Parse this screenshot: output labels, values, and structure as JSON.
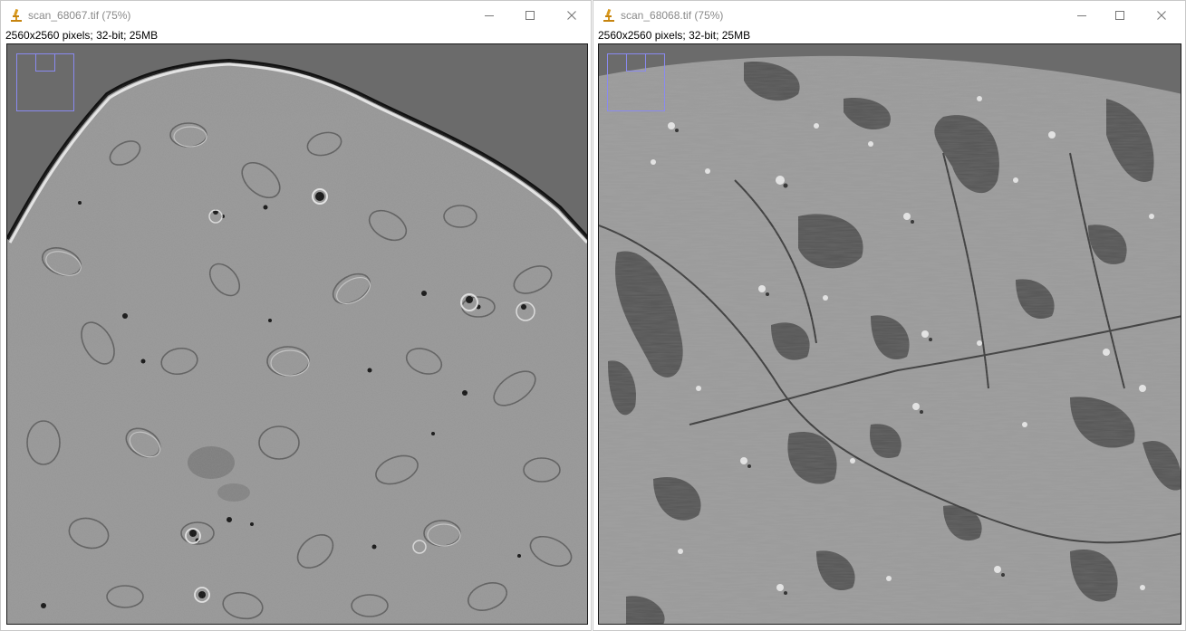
{
  "windows": [
    {
      "title": "scan_68067.tif (75%)",
      "info": "2560x2560 pixels; 32-bit; 25MB"
    },
    {
      "title": "scan_68068.tif (75%)",
      "info": "2560x2560 pixels; 32-bit; 25MB"
    }
  ],
  "icons": {
    "app": "microscope-icon",
    "minimize": "minimize-icon",
    "maximize": "maximize-icon",
    "close": "close-icon"
  },
  "colors": {
    "title_inactive": "#8a8a8a",
    "navigator_rect": "#8a8af0",
    "background_void": "#6b6b6b",
    "tissue_gray": "#979797"
  }
}
